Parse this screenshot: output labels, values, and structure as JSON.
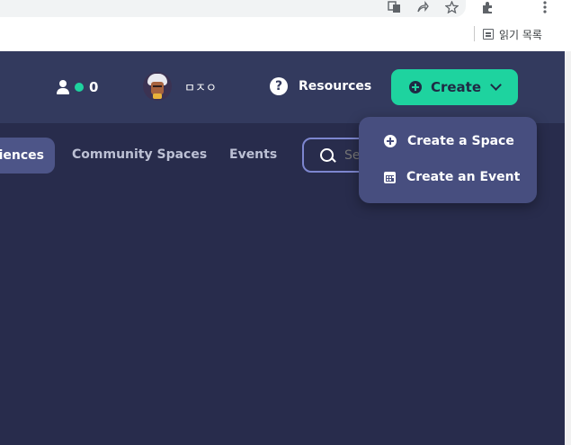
{
  "browser": {
    "bookmarks": {
      "reading_list": "읽기 목록"
    },
    "icons": [
      "translate-icon",
      "share-icon",
      "star-icon",
      "extensions-icon",
      "menu-icon"
    ]
  },
  "header": {
    "online_count": "0",
    "user": {
      "name": "ㅁㅈㅇ"
    },
    "resources_label": "Resources",
    "create_label": "Create"
  },
  "tabs": {
    "active_label": "iences",
    "items": [
      "Community Spaces",
      "Events"
    ]
  },
  "search": {
    "placeholder": "Search"
  },
  "create_menu": {
    "items": [
      "Create a Space",
      "Create an Event"
    ]
  },
  "colors": {
    "accent": "#1ed39f",
    "header_bg": "#333a5e",
    "page_bg": "#282c4c",
    "menu_bg": "#474e7f",
    "active_tab_bg": "#4d5588"
  }
}
